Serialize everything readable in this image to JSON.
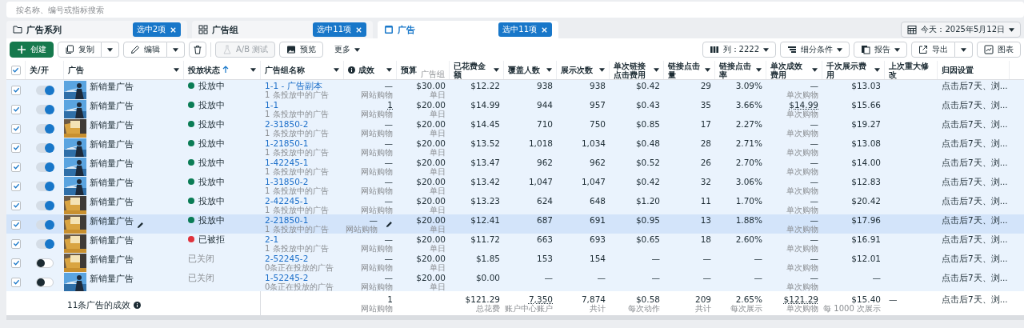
{
  "search": {
    "placeholder": "按名称、编号或指标搜索"
  },
  "tabs": [
    {
      "label": "广告系列",
      "badge": "选中2项",
      "selected": false
    },
    {
      "label": "广告组",
      "badge": "选中11项",
      "selected": false
    },
    {
      "label": "广告",
      "badge": "选中11项",
      "selected": true
    }
  ],
  "date_button": "今天：2025年5月12日",
  "toolbar_left": [
    {
      "label": "创建",
      "kind": "primary",
      "disabled": false
    },
    {
      "label": "复制",
      "kind": "split",
      "disabled": false
    },
    {
      "label": "编辑",
      "kind": "split",
      "disabled": false
    },
    {
      "kind": "icon",
      "disabled": false
    },
    {
      "label": "A/B 测试",
      "kind": "button",
      "disabled": true
    },
    {
      "label": "预览",
      "kind": "button",
      "disabled": false
    },
    {
      "label": "更多",
      "kind": "menu",
      "disabled": false
    }
  ],
  "toolbar_right": [
    {
      "label": "列：2222",
      "kind": "menu"
    },
    {
      "label": "细分条件",
      "kind": "menu"
    },
    {
      "label": "报告",
      "kind": "menu"
    },
    {
      "label": "导出",
      "kind": "split"
    },
    {
      "label": "图表",
      "kind": "button"
    }
  ],
  "table": {
    "select_all": {
      "checked": true
    },
    "columns": [
      {
        "label": "关/开",
        "dropdown": false
      },
      {
        "label": "广告",
        "dropdown": true
      },
      {
        "label": "投放状态",
        "dropdown": true,
        "sort_ascending": true
      },
      {
        "label": "广告组名称",
        "dropdown": true
      },
      {
        "label": "成效",
        "dropdown": true,
        "info": true
      },
      {
        "label": "预算",
        "dropdown": false,
        "sub": "广告组"
      },
      {
        "label": "已花费金额",
        "dropdown": true
      },
      {
        "label": "覆盖人数",
        "dropdown": true
      },
      {
        "label": "展示次数",
        "dropdown": true
      },
      {
        "label": "单次链接点击费用",
        "dropdown": true
      },
      {
        "label": "链接点击量",
        "dropdown": true
      },
      {
        "label": "链接点击率",
        "dropdown": true
      },
      {
        "label": "单次成效费用",
        "dropdown": true
      },
      {
        "label": "千次展示费用",
        "dropdown": true
      },
      {
        "label": "上次重大修改",
        "dropdown": false
      },
      {
        "label": "归因设置",
        "dropdown": false
      }
    ],
    "rows": [
      {
        "checked": true,
        "on": true,
        "hovered": false,
        "name": "新销量广告",
        "status": {
          "label": "投放中",
          "kind": "active"
        },
        "ad_set": {
          "name": "1-1 - 广告副本",
          "sub": "1 条投放中的广告"
        },
        "metrics": {
          "result": {
            "text": "—",
            "sub": "网站购物"
          },
          "budget": {
            "text": "$30.00",
            "sub": "单日"
          },
          "spent": {
            "text": "$12.22"
          },
          "reach": {
            "text": "938"
          },
          "impressions": {
            "text": "938"
          },
          "cpc": {
            "text": "$0.42"
          },
          "clicks": {
            "text": "29"
          },
          "ctr": {
            "text": "3.09%"
          },
          "cost_per_result": {
            "text": "—",
            "sub": "单次购物"
          },
          "cpm": {
            "text": "$13.03"
          },
          "attribution": {
            "text": "点击后7天、浏..."
          }
        }
      },
      {
        "checked": true,
        "on": true,
        "hovered": false,
        "name": "新销量广告",
        "status": {
          "label": "投放中",
          "kind": "active"
        },
        "ad_set": {
          "name": "1-1",
          "sub": "1 条投放中的广告"
        },
        "metrics": {
          "result": {
            "text": "1",
            "sub": "网站购物",
            "underlined": true
          },
          "budget": {
            "text": "$20.00",
            "sub": "单日"
          },
          "spent": {
            "text": "$14.99"
          },
          "reach": {
            "text": "944"
          },
          "impressions": {
            "text": "957"
          },
          "cpc": {
            "text": "$0.43"
          },
          "clicks": {
            "text": "35"
          },
          "ctr": {
            "text": "3.66%"
          },
          "cost_per_result": {
            "text": "$14.99",
            "sub": "单次购物",
            "underlined": true
          },
          "cpm": {
            "text": "$15.66"
          },
          "attribution": {
            "text": "点击后7天、浏..."
          }
        }
      },
      {
        "checked": true,
        "on": true,
        "hovered": false,
        "name": "新销量广告",
        "status": {
          "label": "投放中",
          "kind": "active"
        },
        "ad_set": {
          "name": "2-31850-2",
          "sub": "1 条投放中的广告"
        },
        "metrics": {
          "result": {
            "text": "—",
            "sub": "网站购物"
          },
          "budget": {
            "text": "$20.00",
            "sub": "单日"
          },
          "spent": {
            "text": "$14.45"
          },
          "reach": {
            "text": "710"
          },
          "impressions": {
            "text": "750"
          },
          "cpc": {
            "text": "$0.85"
          },
          "clicks": {
            "text": "17"
          },
          "ctr": {
            "text": "2.27%"
          },
          "cost_per_result": {
            "text": "—",
            "sub": "单次购物"
          },
          "cpm": {
            "text": "$19.27"
          },
          "attribution": {
            "text": "点击后7天、浏..."
          }
        }
      },
      {
        "checked": true,
        "on": true,
        "hovered": false,
        "name": "新销量广告",
        "status": {
          "label": "投放中",
          "kind": "active"
        },
        "ad_set": {
          "name": "1-21850-1",
          "sub": "1 条投放中的广告"
        },
        "metrics": {
          "result": {
            "text": "—",
            "sub": "网站购物"
          },
          "budget": {
            "text": "$20.00",
            "sub": "单日"
          },
          "spent": {
            "text": "$13.52"
          },
          "reach": {
            "text": "1,018"
          },
          "impressions": {
            "text": "1,034"
          },
          "cpc": {
            "text": "$0.48"
          },
          "clicks": {
            "text": "28"
          },
          "ctr": {
            "text": "2.71%"
          },
          "cost_per_result": {
            "text": "—",
            "sub": "单次购物"
          },
          "cpm": {
            "text": "$13.08"
          },
          "attribution": {
            "text": "点击后7天、浏..."
          }
        }
      },
      {
        "checked": true,
        "on": true,
        "hovered": false,
        "name": "新销量广告",
        "status": {
          "label": "投放中",
          "kind": "active"
        },
        "ad_set": {
          "name": "1-42245-1",
          "sub": "1 条投放中的广告"
        },
        "metrics": {
          "result": {
            "text": "—",
            "sub": "网站购物"
          },
          "budget": {
            "text": "$20.00",
            "sub": "单日"
          },
          "spent": {
            "text": "$13.47"
          },
          "reach": {
            "text": "962"
          },
          "impressions": {
            "text": "962"
          },
          "cpc": {
            "text": "$0.52"
          },
          "clicks": {
            "text": "26"
          },
          "ctr": {
            "text": "2.70%"
          },
          "cost_per_result": {
            "text": "—",
            "sub": "单次购物"
          },
          "cpm": {
            "text": "$14.00"
          },
          "attribution": {
            "text": "点击后7天、浏..."
          }
        }
      },
      {
        "checked": true,
        "on": true,
        "hovered": false,
        "name": "新销量广告",
        "status": {
          "label": "投放中",
          "kind": "active"
        },
        "ad_set": {
          "name": "1-31850-2",
          "sub": "1 条投放中的广告"
        },
        "metrics": {
          "result": {
            "text": "—",
            "sub": "网站购物"
          },
          "budget": {
            "text": "$20.00",
            "sub": "单日"
          },
          "spent": {
            "text": "$13.42"
          },
          "reach": {
            "text": "1,047"
          },
          "impressions": {
            "text": "1,047"
          },
          "cpc": {
            "text": "$0.42"
          },
          "clicks": {
            "text": "32"
          },
          "ctr": {
            "text": "3.06%"
          },
          "cost_per_result": {
            "text": "—",
            "sub": "单次购物"
          },
          "cpm": {
            "text": "$12.83"
          },
          "attribution": {
            "text": "点击后7天、浏..."
          }
        }
      },
      {
        "checked": true,
        "on": true,
        "hovered": false,
        "name": "新销量广告",
        "status": {
          "label": "投放中",
          "kind": "active"
        },
        "ad_set": {
          "name": "2-42245-1",
          "sub": "1 条投放中的广告"
        },
        "metrics": {
          "result": {
            "text": "—",
            "sub": "网站购物"
          },
          "budget": {
            "text": "$20.00",
            "sub": "单日"
          },
          "spent": {
            "text": "$13.23"
          },
          "reach": {
            "text": "624"
          },
          "impressions": {
            "text": "648"
          },
          "cpc": {
            "text": "$1.20"
          },
          "clicks": {
            "text": "11"
          },
          "ctr": {
            "text": "1.70%"
          },
          "cost_per_result": {
            "text": "—",
            "sub": "单次购物"
          },
          "cpm": {
            "text": "$20.42"
          },
          "attribution": {
            "text": "点击后7天、浏..."
          }
        }
      },
      {
        "checked": true,
        "on": true,
        "hovered": true,
        "name": "新销量广告",
        "status": {
          "label": "投放中",
          "kind": "active"
        },
        "ad_set": {
          "name": "2-21850-1",
          "sub": "1 条投放中的广告"
        },
        "metrics": {
          "result": {
            "text": "—",
            "sub": "网站购物"
          },
          "budget": {
            "text": "$20.00",
            "sub": "单日"
          },
          "spent": {
            "text": "$12.41"
          },
          "reach": {
            "text": "687"
          },
          "impressions": {
            "text": "691"
          },
          "cpc": {
            "text": "$0.95"
          },
          "clicks": {
            "text": "13"
          },
          "ctr": {
            "text": "1.88%"
          },
          "cost_per_result": {
            "text": "—",
            "sub": "单次购物"
          },
          "cpm": {
            "text": "$17.96"
          },
          "attribution": {
            "text": "点击后7天、浏..."
          }
        }
      },
      {
        "checked": true,
        "on": true,
        "hovered": false,
        "name": "新销量广告",
        "status": {
          "label": "已被拒",
          "kind": "rejected"
        },
        "ad_set": {
          "name": "2-1",
          "sub": "1 条投放中的广告"
        },
        "metrics": {
          "result": {
            "text": "—",
            "sub": "网站购物"
          },
          "budget": {
            "text": "$20.00",
            "sub": "单日"
          },
          "spent": {
            "text": "$11.72"
          },
          "reach": {
            "text": "663"
          },
          "impressions": {
            "text": "693"
          },
          "cpc": {
            "text": "$0.65"
          },
          "clicks": {
            "text": "18"
          },
          "ctr": {
            "text": "2.60%"
          },
          "cost_per_result": {
            "text": "—",
            "sub": "单次购物"
          },
          "cpm": {
            "text": "$16.91"
          },
          "attribution": {
            "text": "点击后7天、浏..."
          }
        }
      },
      {
        "checked": true,
        "on": false,
        "hovered": false,
        "name": "新销量广告",
        "status": {
          "label": "已关闭",
          "kind": "off"
        },
        "ad_set": {
          "name": "2-52245-2",
          "sub": "0条正在投放的广告"
        },
        "metrics": {
          "result": {
            "text": "—",
            "sub": "网站购物"
          },
          "budget": {
            "text": "$20.00",
            "sub": "单日"
          },
          "spent": {
            "text": "$1.85"
          },
          "reach": {
            "text": "153"
          },
          "impressions": {
            "text": "154"
          },
          "cpc": {
            "text": "—"
          },
          "clicks": {
            "text": "—"
          },
          "ctr": {
            "text": "—"
          },
          "cost_per_result": {
            "text": "—",
            "sub": "单次购物"
          },
          "cpm": {
            "text": "$12.01"
          },
          "attribution": {
            "text": "点击后7天、浏..."
          }
        }
      },
      {
        "checked": true,
        "on": false,
        "hovered": false,
        "name": "新销量广告",
        "status": {
          "label": "已关闭",
          "kind": "off"
        },
        "ad_set": {
          "name": "1-52245-2",
          "sub": "0条正在投放的广告"
        },
        "metrics": {
          "result": {
            "text": "—",
            "sub": "网站购物"
          },
          "budget": {
            "text": "$20.00",
            "sub": "单日"
          },
          "spent": {
            "text": "$0.00"
          },
          "reach": {
            "text": "—"
          },
          "impressions": {
            "text": "—"
          },
          "cpc": {
            "text": "—"
          },
          "clicks": {
            "text": "—"
          },
          "ctr": {
            "text": "—"
          },
          "cost_per_result": {
            "text": "—",
            "sub": "单次购物"
          },
          "cpm": {
            "text": "—"
          },
          "attribution": {
            "text": "点击后7天、浏..."
          }
        }
      }
    ],
    "total": {
      "label": "11条广告的成效",
      "info": true,
      "metrics": {
        "result": {
          "text": "1",
          "sub": "网站购物"
        },
        "spent": {
          "text": "$121.29",
          "sub": "总花费"
        },
        "reach": {
          "text": "7,350",
          "sub": "账户中心账户",
          "underlined": true
        },
        "impressions": {
          "text": "7,874",
          "sub": "共计"
        },
        "cpc": {
          "text": "$0.58",
          "sub": "每次动作"
        },
        "clicks": {
          "text": "209",
          "sub": "共计"
        },
        "ctr": {
          "text": "2.65%",
          "sub": "每次展示"
        },
        "cost_per_result": {
          "text": "$121.29",
          "sub": "单次购物",
          "underlined": true
        },
        "cpm": {
          "text": "$15.40",
          "sub": "每 1000 次展示"
        },
        "last_edit": {
          "text": "—"
        },
        "attribution": {
          "text": "点击后7天、浏..."
        }
      }
    }
  }
}
